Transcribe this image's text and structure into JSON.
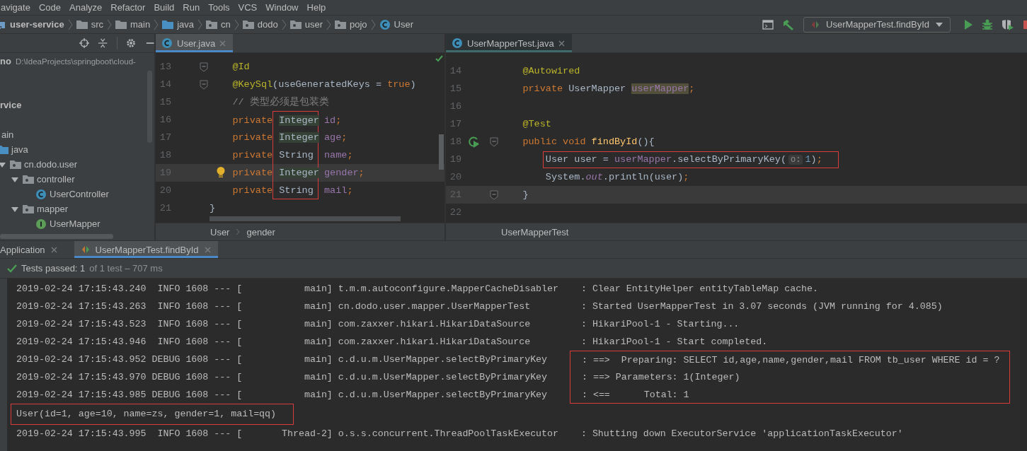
{
  "menu": [
    "avigate",
    "Code",
    "Analyze",
    "Refactor",
    "Build",
    "Run",
    "Tools",
    "VCS",
    "Window",
    "Help"
  ],
  "breadcrumbs": [
    {
      "label": "user-service",
      "kind": "module"
    },
    {
      "label": "src",
      "kind": "folder"
    },
    {
      "label": "main",
      "kind": "folder"
    },
    {
      "label": "java",
      "kind": "source"
    },
    {
      "label": "cn",
      "kind": "package"
    },
    {
      "label": "dodo",
      "kind": "package"
    },
    {
      "label": "user",
      "kind": "package"
    },
    {
      "label": "pojo",
      "kind": "package"
    },
    {
      "label": "User",
      "kind": "class"
    }
  ],
  "run_config": {
    "label": "UserMapperTest.findById"
  },
  "project_tree": [
    {
      "name": "no",
      "path": "D:\\IdeaProjects\\springboot\\cloud-",
      "kind": "project"
    },
    {
      "name": "rvice",
      "kind": "module"
    },
    {
      "name": "ain",
      "kind": "plain",
      "children": [
        {
          "name": "java",
          "kind": "source",
          "children": [
            {
              "name": "cn.dodo.user",
              "kind": "package",
              "expanded": true,
              "children": [
                {
                  "name": "controller",
                  "kind": "package",
                  "expanded": true,
                  "children": [
                    {
                      "name": "UserController",
                      "kind": "class"
                    }
                  ]
                },
                {
                  "name": "mapper",
                  "kind": "package",
                  "expanded": true,
                  "children": [
                    {
                      "name": "UserMapper",
                      "kind": "interface"
                    }
                  ]
                }
              ]
            }
          ]
        }
      ]
    }
  ],
  "editors": [
    {
      "tab": {
        "label": "User.java",
        "selected": true
      },
      "breadcrumb": [
        "User",
        "gender"
      ],
      "lines": [
        {
          "number": "13",
          "current": false,
          "fold": true,
          "kind": "member",
          "tokens": [
            {
              "text": "@Id",
              "kind": "annotation"
            }
          ]
        },
        {
          "number": "14",
          "current": false,
          "fold": true,
          "kind": "member",
          "tokens": [
            {
              "text": "@KeySql",
              "kind": "annotation"
            },
            {
              "text": "(useGeneratedKeys = ",
              "kind": "plain"
            },
            {
              "text": "true",
              "kind": "keyword"
            },
            {
              "text": ")",
              "kind": "plain"
            }
          ]
        },
        {
          "number": "15",
          "current": false,
          "kind": "member",
          "tokens": [
            {
              "text": "// 类型必须是包装类",
              "kind": "comment"
            }
          ]
        },
        {
          "number": "16",
          "current": false,
          "kind": "member",
          "tokens": [
            {
              "text": "private",
              "kind": "keyword"
            },
            {
              "text": "Integer",
              "kind": "plain",
              "highlighted": true,
              "boxed": true
            },
            {
              "text": "id",
              "kind": "field"
            },
            {
              "text": ";",
              "kind": "keyword"
            }
          ]
        },
        {
          "number": "17",
          "current": false,
          "kind": "member",
          "tokens": [
            {
              "text": "private",
              "kind": "keyword"
            },
            {
              "text": "Integer",
              "kind": "plain",
              "highlighted": true,
              "boxed": true
            },
            {
              "text": "age",
              "kind": "field"
            },
            {
              "text": ";",
              "kind": "keyword"
            }
          ]
        },
        {
          "number": "18",
          "current": false,
          "kind": "member",
          "tokens": [
            {
              "text": "private",
              "kind": "keyword"
            },
            {
              "text": "String",
              "kind": "plain",
              "boxed": true
            },
            {
              "text": "name",
              "kind": "field"
            },
            {
              "text": ";",
              "kind": "keyword"
            }
          ]
        },
        {
          "number": "19",
          "current": true,
          "bulb": true,
          "kind": "member",
          "tokens": [
            {
              "text": "private",
              "kind": "keyword"
            },
            {
              "text": "Integer",
              "kind": "plain",
              "highlighted": true,
              "boxed": true
            },
            {
              "text": "gender",
              "kind": "field"
            },
            {
              "text": ";",
              "kind": "keyword"
            }
          ]
        },
        {
          "number": "20",
          "current": false,
          "kind": "member",
          "tokens": [
            {
              "text": "private",
              "kind": "keyword"
            },
            {
              "text": "String",
              "kind": "plain",
              "boxed": true
            },
            {
              "text": "mail",
              "kind": "field"
            },
            {
              "text": ";",
              "kind": "keyword"
            }
          ]
        },
        {
          "number": "21",
          "current": false,
          "kind": "top",
          "tokens": [
            {
              "text": "}",
              "kind": "plain"
            }
          ]
        }
      ]
    },
    {
      "tab": {
        "label": "UserMapperTest.java",
        "selected": true
      },
      "breadcrumb": [
        "UserMapperTest"
      ],
      "lines": [
        {
          "number": "14",
          "current": false,
          "kind": "member",
          "tokens": [
            {
              "text": "@Autowired",
              "kind": "annotation"
            }
          ]
        },
        {
          "number": "15",
          "current": false,
          "kind": "member",
          "tokens": [
            {
              "text": "private ",
              "kind": "keyword"
            },
            {
              "text": "UserMapper ",
              "kind": "plain"
            },
            {
              "text": "userMapper",
              "kind": "field",
              "highlighted": true
            },
            {
              "text": ";",
              "kind": "keyword"
            }
          ]
        },
        {
          "number": "16",
          "current": false
        },
        {
          "number": "17",
          "current": false,
          "kind": "member",
          "tokens": [
            {
              "text": "@Test",
              "kind": "annotation"
            }
          ]
        },
        {
          "number": "18",
          "current": false,
          "run": true,
          "fold": true,
          "kind": "member",
          "tokens": [
            {
              "text": "public void ",
              "kind": "keyword"
            },
            {
              "text": "findById",
              "kind": "method"
            },
            {
              "text": "(){",
              "kind": "plain"
            }
          ]
        },
        {
          "number": "19",
          "current": false,
          "boxed": true,
          "kind": "body",
          "tokens": [
            {
              "text": "User user = ",
              "kind": "plain"
            },
            {
              "text": "userMapper",
              "kind": "field"
            },
            {
              "text": ".selectByPrimaryKey(",
              "kind": "plain"
            },
            {
              "text": "o:",
              "kind": "hint"
            },
            {
              "text": "1",
              "kind": "number"
            },
            {
              "text": ")",
              "kind": "plain"
            },
            {
              "text": ";",
              "kind": "keyword"
            }
          ]
        },
        {
          "number": "20",
          "current": false,
          "kind": "body",
          "tokens": [
            {
              "text": "System.",
              "kind": "plain"
            },
            {
              "text": "out",
              "kind": "static"
            },
            {
              "text": ".println(user)",
              "kind": "plain"
            },
            {
              "text": ";",
              "kind": "keyword"
            }
          ]
        },
        {
          "number": "21",
          "current": true,
          "fold": true,
          "kind": "member",
          "tokens": [
            {
              "text": "}",
              "kind": "plain"
            }
          ]
        },
        {
          "number": "22",
          "current": false
        }
      ]
    }
  ],
  "run_tabs": [
    {
      "label": "Application",
      "kind": "app",
      "selected": false
    },
    {
      "label": "UserMapperTest.findById",
      "kind": "test",
      "selected": true
    }
  ],
  "test_status": {
    "label": "Tests passed: 1",
    "detail": "of 1 test – 707 ms"
  },
  "console": [
    {
      "kind": "log",
      "prefix": "2019-02-24 17:15:43.240  INFO 1608 --- [           main]",
      "logger": "t.m.m.autoconfigure.MapperCacheDisabler",
      "message": ": Clear EntityHelper entityTableMap cache.",
      "boxed": false
    },
    {
      "kind": "log",
      "prefix": "2019-02-24 17:15:43.263  INFO 1608 --- [           main]",
      "logger": "cn.dodo.user.mapper.UserMapperTest",
      "message": ": Started UserMapperTest in 3.07 seconds (JVM running for 4.085)",
      "boxed": false
    },
    {
      "kind": "log",
      "prefix": "2019-02-24 17:15:43.523  INFO 1608 --- [           main]",
      "logger": "com.zaxxer.hikari.HikariDataSource",
      "message": ": HikariPool-1 - Starting...",
      "boxed": false
    },
    {
      "kind": "log",
      "prefix": "2019-02-24 17:15:43.946  INFO 1608 --- [           main]",
      "logger": "com.zaxxer.hikari.HikariDataSource",
      "message": ": HikariPool-1 - Start completed.",
      "boxed": false
    },
    {
      "kind": "log",
      "prefix": "2019-02-24 17:15:43.952 DEBUG 1608 --- [           main]",
      "logger": "c.d.u.m.UserMapper.selectByPrimaryKey",
      "message": ": ==>  Preparing: SELECT id,age,name,gender,mail FROM tb_user WHERE id = ?",
      "boxed": true
    },
    {
      "kind": "log",
      "prefix": "2019-02-24 17:15:43.970 DEBUG 1608 --- [           main]",
      "logger": "c.d.u.m.UserMapper.selectByPrimaryKey",
      "message": ": ==> Parameters: 1(Integer)",
      "boxed": true
    },
    {
      "kind": "log",
      "prefix": "2019-02-24 17:15:43.985 DEBUG 1608 --- [           main]",
      "logger": "c.d.u.m.UserMapper.selectByPrimaryKey",
      "message": ": <==      Total: 1",
      "boxed": true
    },
    {
      "kind": "output",
      "message": "User(id=1, age=10, name=zs, gender=1, mail=qq)",
      "boxed": true
    },
    {
      "kind": "log",
      "prefix": "2019-02-24 17:15:43.995  INFO 1608 --- [       Thread-2]",
      "logger": "o.s.s.concurrent.ThreadPoolTaskExecutor",
      "message": ": Shutting down ExecutorService 'applicationTaskExecutor'",
      "boxed": false
    }
  ]
}
